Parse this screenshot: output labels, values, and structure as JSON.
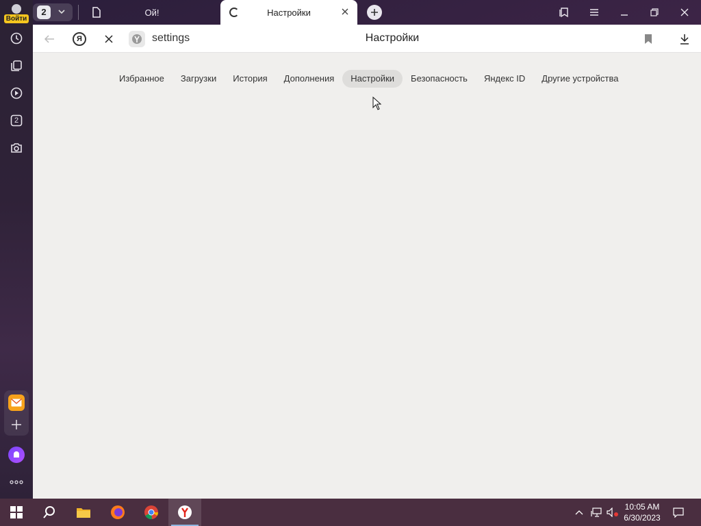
{
  "sidebar": {
    "profile_label": "Войти",
    "counter_badge": "2"
  },
  "tabs": {
    "count": "2",
    "items": [
      {
        "title": "Ой!"
      },
      {
        "title": "Настройки"
      }
    ]
  },
  "toolbar": {
    "address_text": "settings",
    "page_title": "Настройки",
    "ya_label": "Я"
  },
  "settings_nav": {
    "items": [
      {
        "label": "Избранное"
      },
      {
        "label": "Загрузки"
      },
      {
        "label": "История"
      },
      {
        "label": "Дополнения"
      },
      {
        "label": "Настройки",
        "active": true
      },
      {
        "label": "Безопасность"
      },
      {
        "label": "Яндекс ID"
      },
      {
        "label": "Другие устройства"
      }
    ]
  },
  "taskbar": {
    "time": "10:05 AM",
    "date": "6/30/2023"
  },
  "colors": {
    "content_bg": "#f0efed",
    "active_pill": "#dedddb",
    "profile_badge": "#f5c61f"
  }
}
